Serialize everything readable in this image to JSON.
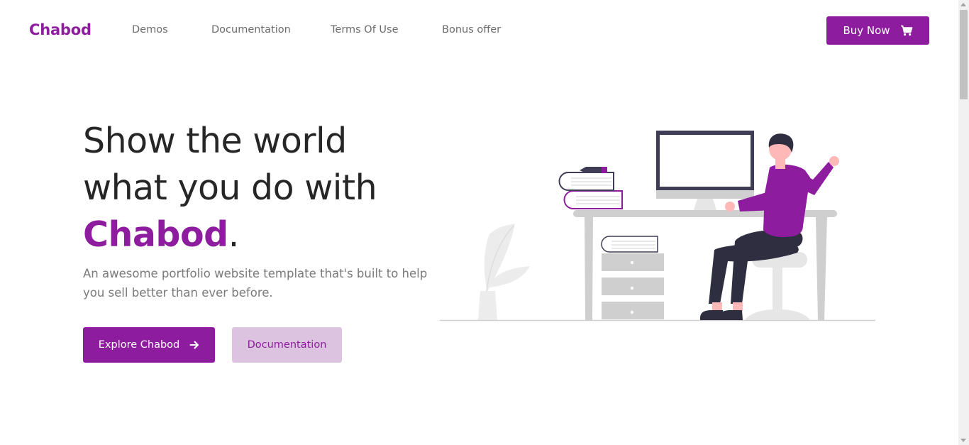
{
  "nav": {
    "brand": "Chabod",
    "links": [
      "Demos",
      "Documentation",
      "Terms Of Use",
      "Bonus offer"
    ],
    "buy_label": "Buy Now",
    "buy_icon": "cart-icon"
  },
  "hero": {
    "line1": "Show the world",
    "line2": "what you do with",
    "brand_word": "Chabod",
    "punct": ".",
    "subtitle": "An awesome portfolio website template that's built to help you sell better than ever before.",
    "primary_label": "Explore Chabod",
    "primary_icon": "arrow-right-icon",
    "secondary_label": "Documentation"
  },
  "colors": {
    "accent": "#8e1c9e",
    "accent_light": "#dcc3e0",
    "text_dark": "#262626",
    "text_muted": "#7a7a7a",
    "nav_text": "#6b6b6b"
  }
}
